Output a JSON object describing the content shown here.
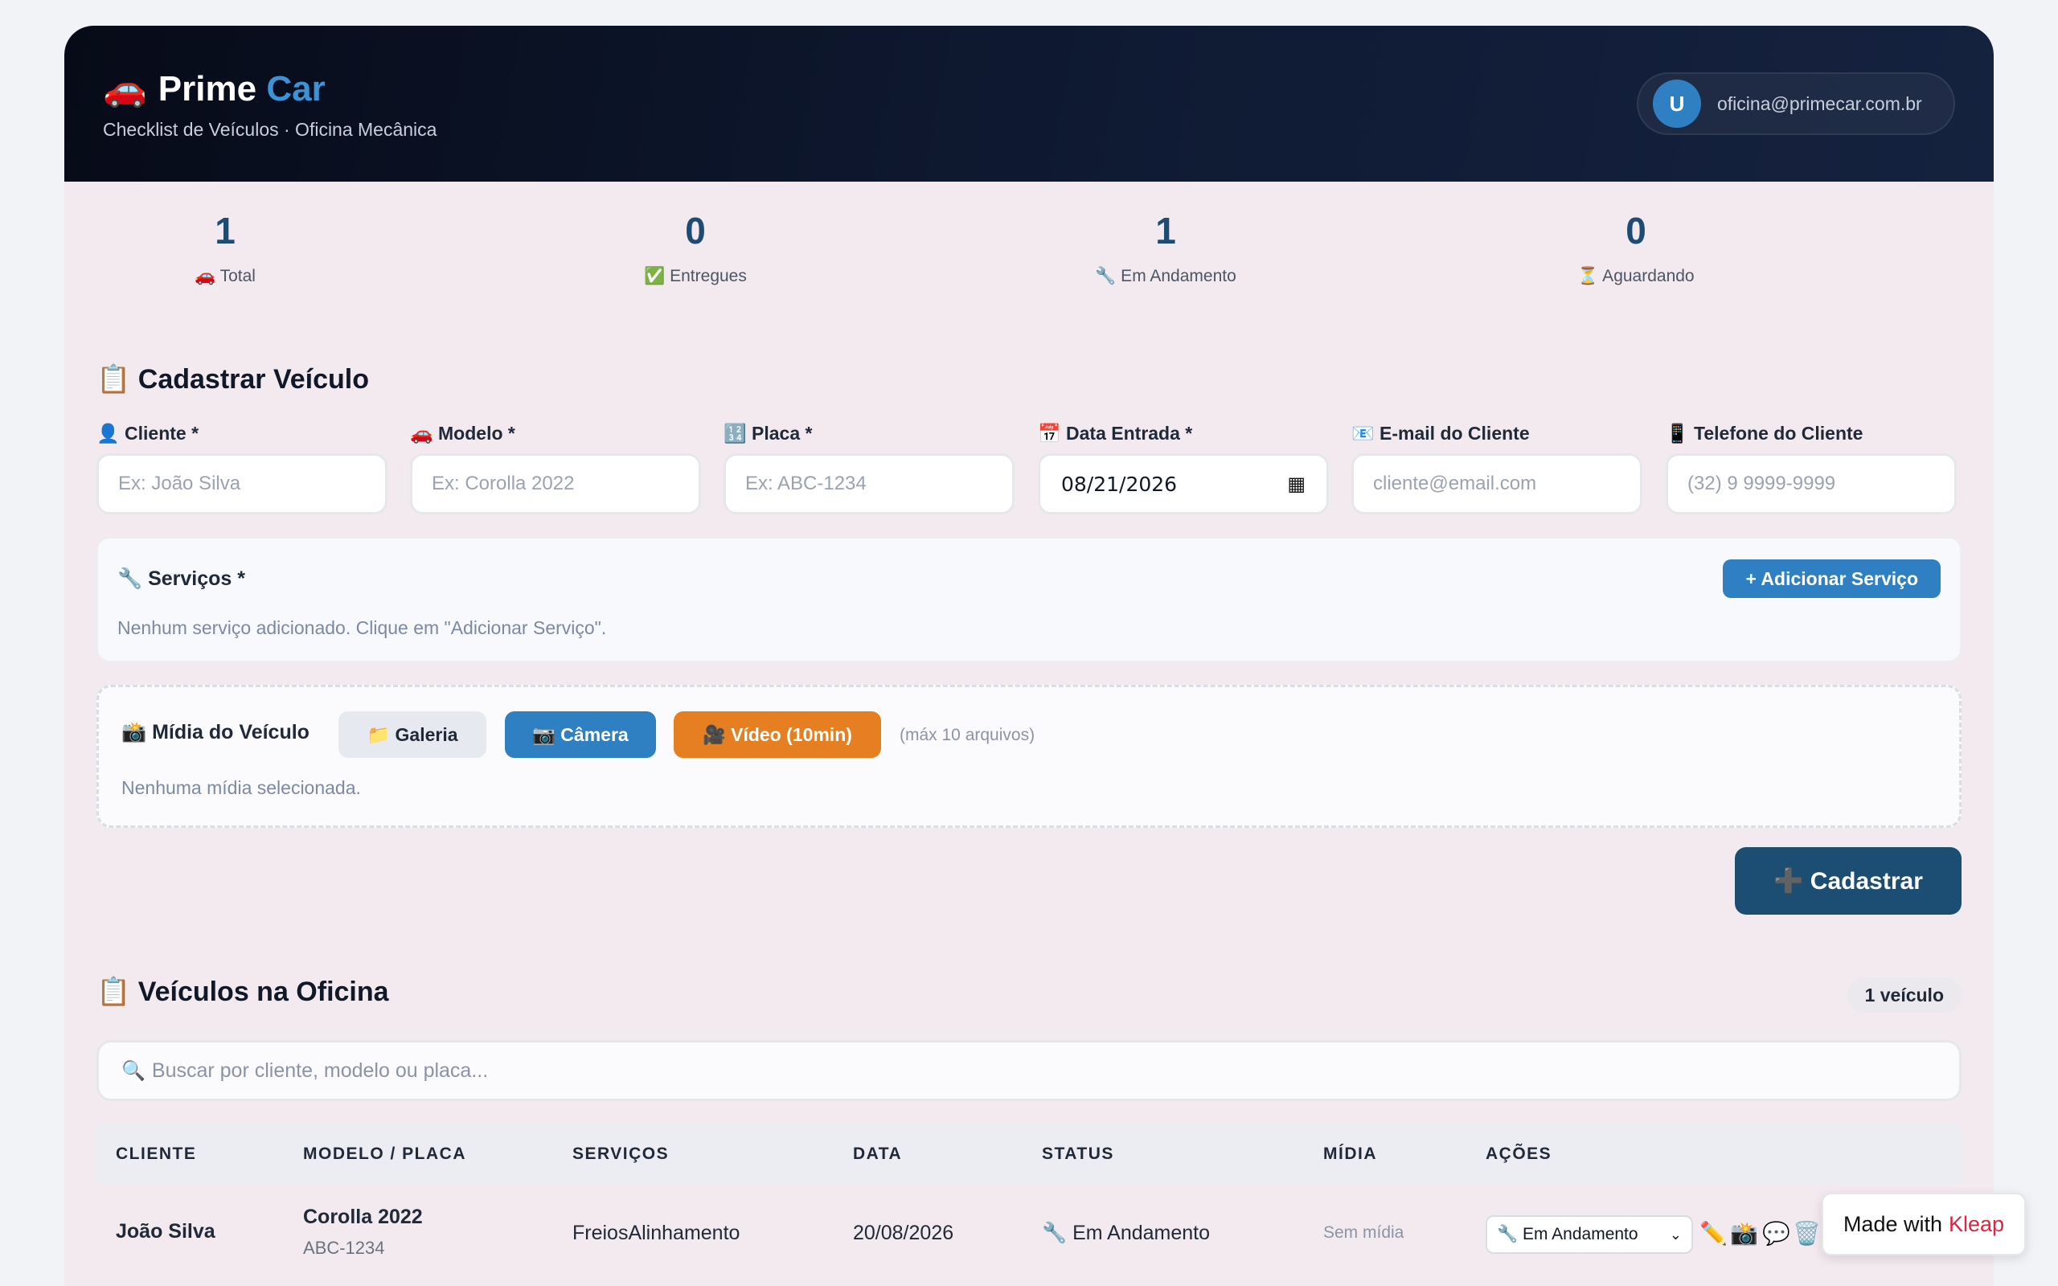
{
  "header": {
    "brand_icon": "🚗",
    "brand_name": "Prime",
    "brand_accent": "Car",
    "subtitle": "Checklist de Veículos · Oficina Mecânica",
    "user_initial": "U",
    "user_email": "oficina@primecar.com.br"
  },
  "stats": [
    {
      "value": "1",
      "label": "🚗 Total"
    },
    {
      "value": "0",
      "label": "✅ Entregues"
    },
    {
      "value": "1",
      "label": "🔧 Em Andamento"
    },
    {
      "value": "0",
      "label": "⏳ Aguardando"
    }
  ],
  "register": {
    "title": "📋 Cadastrar Veículo",
    "fields": [
      {
        "label": "👤 Cliente *",
        "placeholder": "Ex: João Silva",
        "value": ""
      },
      {
        "label": "🚗 Modelo *",
        "placeholder": "Ex: Corolla 2022",
        "value": ""
      },
      {
        "label": "🔢 Placa *",
        "placeholder": "Ex: ABC-1234",
        "value": ""
      },
      {
        "label": "📅 Data Entrada *",
        "placeholder": "",
        "value": "08/21/2026"
      },
      {
        "label": "📧 E-mail do Cliente",
        "placeholder": "cliente@email.com",
        "value": ""
      },
      {
        "label": "📱 Telefone do Cliente",
        "placeholder": "(32) 9 9999-9999",
        "value": ""
      }
    ],
    "services": {
      "title": "🔧 Serviços *",
      "add_button": "+ Adicionar Serviço",
      "empty_text": "Nenhum serviço adicionado. Clique em \"Adicionar Serviço\"."
    },
    "media": {
      "title": "📸 Mídia do Veículo",
      "gallery_button": "📁 Galeria",
      "camera_button": "📷 Câmera",
      "video_button": "🎥 Vídeo (10min)",
      "hint": "(máx 10 arquivos)",
      "empty_text": "Nenhuma mídia selecionada."
    },
    "submit_button": "➕ Cadastrar"
  },
  "vehicles": {
    "title": "📋 Veículos na Oficina",
    "count_badge": "1 veículo",
    "search_icon": "🔍",
    "search_placeholder": "Buscar por cliente, modelo ou placa...",
    "columns": [
      "CLIENTE",
      "MODELO / PLACA",
      "SERVIÇOS",
      "DATA",
      "STATUS",
      "MÍDIA",
      "AÇÕES"
    ],
    "rows": [
      {
        "client": "João Silva",
        "model": "Corolla 2022",
        "plate": "ABC-1234",
        "services": "FreiosAlinhamento",
        "date": "20/08/2026",
        "status": "🔧 Em Andamento",
        "media": "Sem mídia",
        "status_select": "🔧 Em Andamento",
        "action_icons": [
          "✏️",
          "📸",
          "💬",
          "🗑️"
        ]
      }
    ]
  },
  "badge": {
    "prefix": "Made with",
    "brand": "Kleap"
  },
  "colors": {
    "accent": "#2f80c2",
    "primary_dark": "#1b4e72",
    "video_orange": "#e67e22",
    "kleap_red": "#e0243f"
  }
}
